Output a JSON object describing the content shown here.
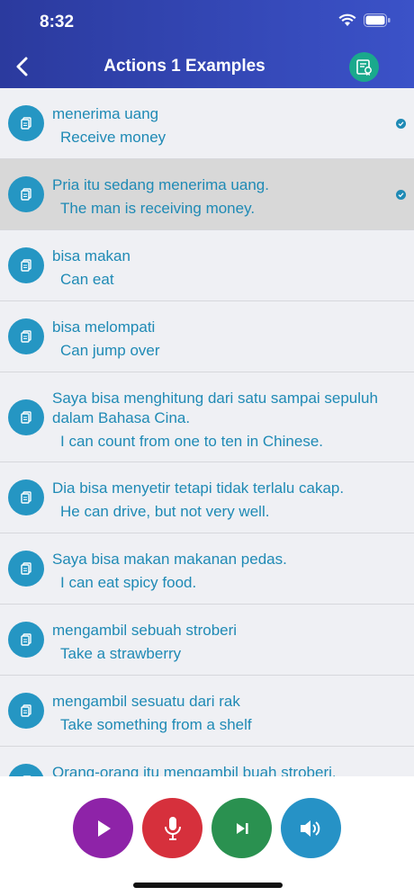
{
  "status_bar": {
    "time": "8:32"
  },
  "header": {
    "title": "Actions 1 Examples"
  },
  "items": [
    {
      "primary": "menerima uang",
      "secondary": "Receive money",
      "checked": true,
      "selected": false
    },
    {
      "primary": "Pria itu sedang menerima uang.",
      "secondary": "The man is receiving money.",
      "checked": true,
      "selected": true
    },
    {
      "primary": "bisa makan",
      "secondary": "Can eat",
      "checked": false,
      "selected": false
    },
    {
      "primary": "bisa melompati",
      "secondary": "Can jump over",
      "checked": false,
      "selected": false
    },
    {
      "primary": "Saya bisa menghitung dari satu sampai sepuluh dalam Bahasa Cina.",
      "secondary": "I can count from one to ten in Chinese.",
      "checked": false,
      "selected": false
    },
    {
      "primary": "Dia bisa menyetir tetapi tidak terlalu cakap.",
      "secondary": "He can drive, but not very well.",
      "checked": false,
      "selected": false
    },
    {
      "primary": "Saya bisa makan makanan pedas.",
      "secondary": "I can eat spicy food.",
      "checked": false,
      "selected": false
    },
    {
      "primary": "mengambil sebuah stroberi",
      "secondary": "Take a strawberry",
      "checked": false,
      "selected": false
    },
    {
      "primary": "mengambil sesuatu dari rak",
      "secondary": "Take something from a shelf",
      "checked": false,
      "selected": false
    },
    {
      "primary": "Orang-orang itu mengambil buah stroberi.",
      "secondary": "",
      "checked": false,
      "selected": false
    }
  ],
  "controls": [
    {
      "name": "play-button",
      "icon": "play-icon",
      "color": "#8e23a8"
    },
    {
      "name": "record-button",
      "icon": "microphone-icon",
      "color": "#d6303c"
    },
    {
      "name": "next-button",
      "icon": "skip-next-icon",
      "color": "#2a9150"
    },
    {
      "name": "speaker-button",
      "icon": "speaker-icon",
      "color": "#2692c6"
    }
  ],
  "colors": {
    "header": "#3344b8",
    "accent": "#1f8ab5",
    "badge": "#1aa98c",
    "selected_row": "#d8d8d8"
  }
}
